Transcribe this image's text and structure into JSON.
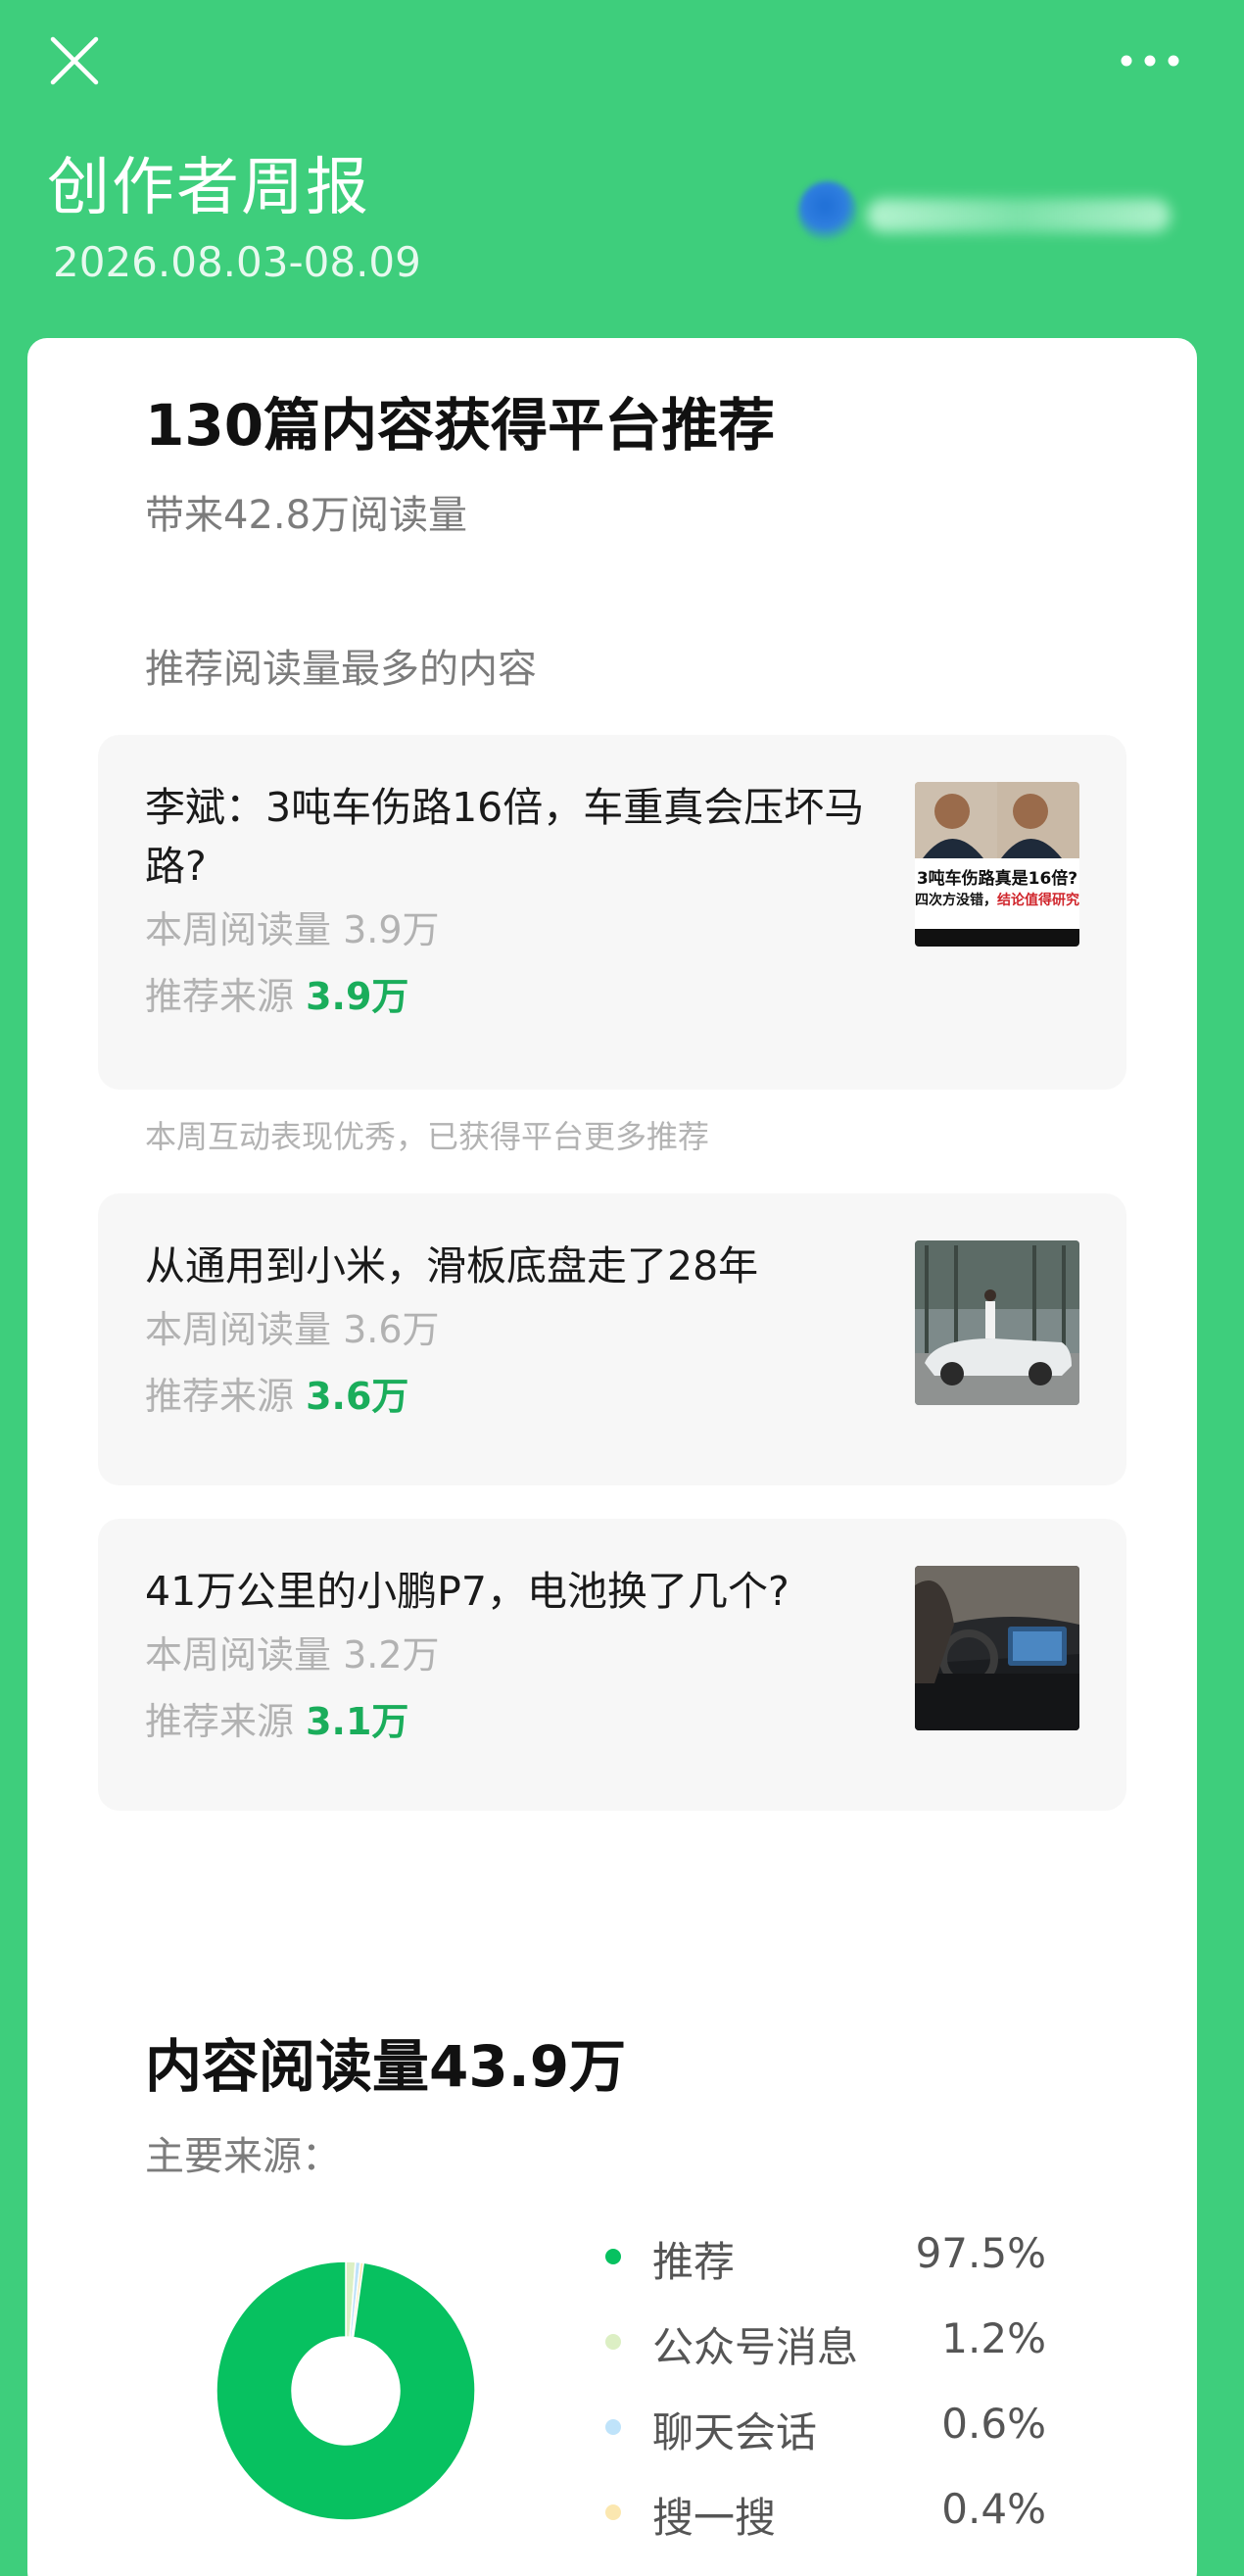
{
  "header": {
    "title": "创作者周报",
    "date_range": "2026.08.03-08.09",
    "close_icon": "close-icon",
    "more_icon": "more-icon"
  },
  "recommend": {
    "title": "130篇内容获得平台推荐",
    "subtitle": "带来42.8万阅读量",
    "top_label": "推荐阅读量最多的内容",
    "items": [
      {
        "title": "李斌：3吨车伤路16倍，车重真会压坏马路?",
        "reads_label": "本周阅读量",
        "reads": "3.9万",
        "source_label": "推荐来源",
        "source": "3.9万",
        "note": "本周互动表现优秀，已获得平台更多推荐",
        "thumb_top": "3吨车伤路真是16倍?",
        "thumb_mid": "四次方没错，",
        "thumb_hl": "结论值得研究"
      },
      {
        "title": "从通用到小米，滑板底盘走了28年",
        "reads_label": "本周阅读量",
        "reads": "3.6万",
        "source_label": "推荐来源",
        "source": "3.6万"
      },
      {
        "title": "41万公里的小鹏P7，电池换了几个?",
        "reads_label": "本周阅读量",
        "reads": "3.2万",
        "source_label": "推荐来源",
        "source": "3.1万"
      }
    ]
  },
  "reads": {
    "title": "内容阅读量43.9万",
    "subtitle": "主要来源：",
    "legend": [
      {
        "label": "推荐",
        "value": "97.5%",
        "color": "#07c160"
      },
      {
        "label": "公众号消息",
        "value": "1.2%",
        "color": "#dcefc4"
      },
      {
        "label": "聊天会话",
        "value": "0.6%",
        "color": "#bfe3fa"
      },
      {
        "label": "搜一搜",
        "value": "0.4%",
        "color": "#fbe7b0"
      }
    ]
  },
  "chart_data": {
    "type": "pie",
    "title": "",
    "categories": [
      "推荐",
      "公众号消息",
      "聊天会话",
      "搜一搜"
    ],
    "values": [
      97.5,
      1.2,
      0.6,
      0.4
    ],
    "colors": [
      "#07c160",
      "#dcefc4",
      "#bfe3fa",
      "#fbe7b0"
    ],
    "donut": true
  }
}
